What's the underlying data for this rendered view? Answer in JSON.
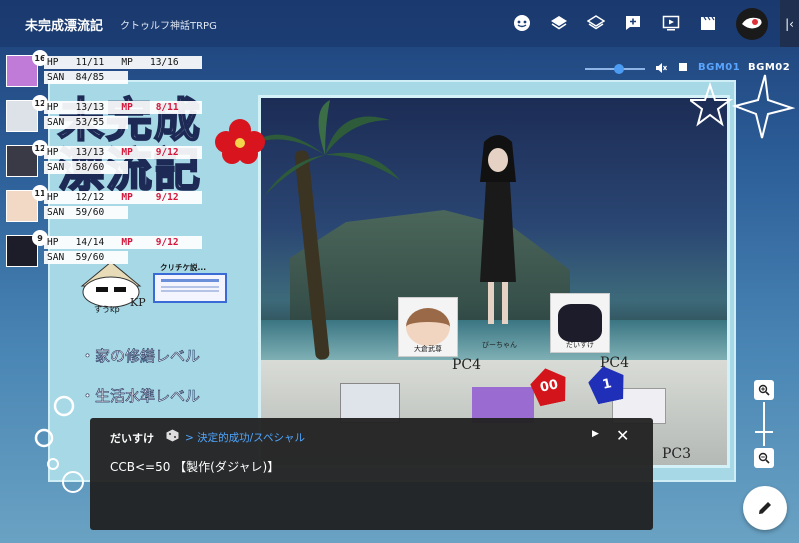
{
  "app": {
    "title": "未完成漂流記",
    "subtitle": "クトゥルフ神話TRPG"
  },
  "toolbar": {
    "icons": [
      "face-icon",
      "layers-icon",
      "layers-outline-icon",
      "chat-add-icon",
      "video-icon",
      "clapper-icon"
    ]
  },
  "bgm": {
    "tracks": [
      "BGM01",
      "BGM02"
    ],
    "volume": 0.5
  },
  "board": {
    "title_art": "未完成漂流記",
    "items": [
      "・家の修繕レベル",
      "・生活水準レベル"
    ],
    "kp_label": "KP",
    "kp_sub": "すうkp",
    "critical_card_label": "クリチケ説...",
    "pc_labels": [
      "PC4",
      "PC4",
      "PC3"
    ],
    "characters": [
      {
        "name": "大倉武尊"
      },
      {
        "name": "びーちゃん"
      },
      {
        "name": "だいすけ"
      }
    ],
    "dice": [
      "00",
      "1"
    ]
  },
  "status": [
    {
      "badge": "16",
      "hp": "HP   11/11",
      "mp": "MP   13/16",
      "mp_low": false,
      "san": "SAN  84/85"
    },
    {
      "badge": "12",
      "hp": "HP   13/13",
      "mp": "MP    8/11",
      "mp_low": true,
      "san": "SAN  53/55"
    },
    {
      "badge": "12",
      "hp": "HP   13/13",
      "mp": "MP    9/12",
      "mp_low": true,
      "san": "SAN  58/60"
    },
    {
      "badge": "11",
      "hp": "HP   12/12",
      "mp": "MP    9/12",
      "mp_low": true,
      "san": "SAN  59/60"
    },
    {
      "badge": "9",
      "hp": "HP   14/14",
      "mp": "MP    9/12",
      "mp_low": true,
      "san": "SAN  59/60"
    }
  ],
  "chat": {
    "name": "だいすけ",
    "result": "> 決定的成功/スペシャル",
    "message": "CCB<=50 【製作(ダジャレ)】"
  },
  "colors": {
    "accent": "#4c9cf3",
    "chat_result": "#4fa6ff",
    "mp_low": "#d3173b"
  }
}
